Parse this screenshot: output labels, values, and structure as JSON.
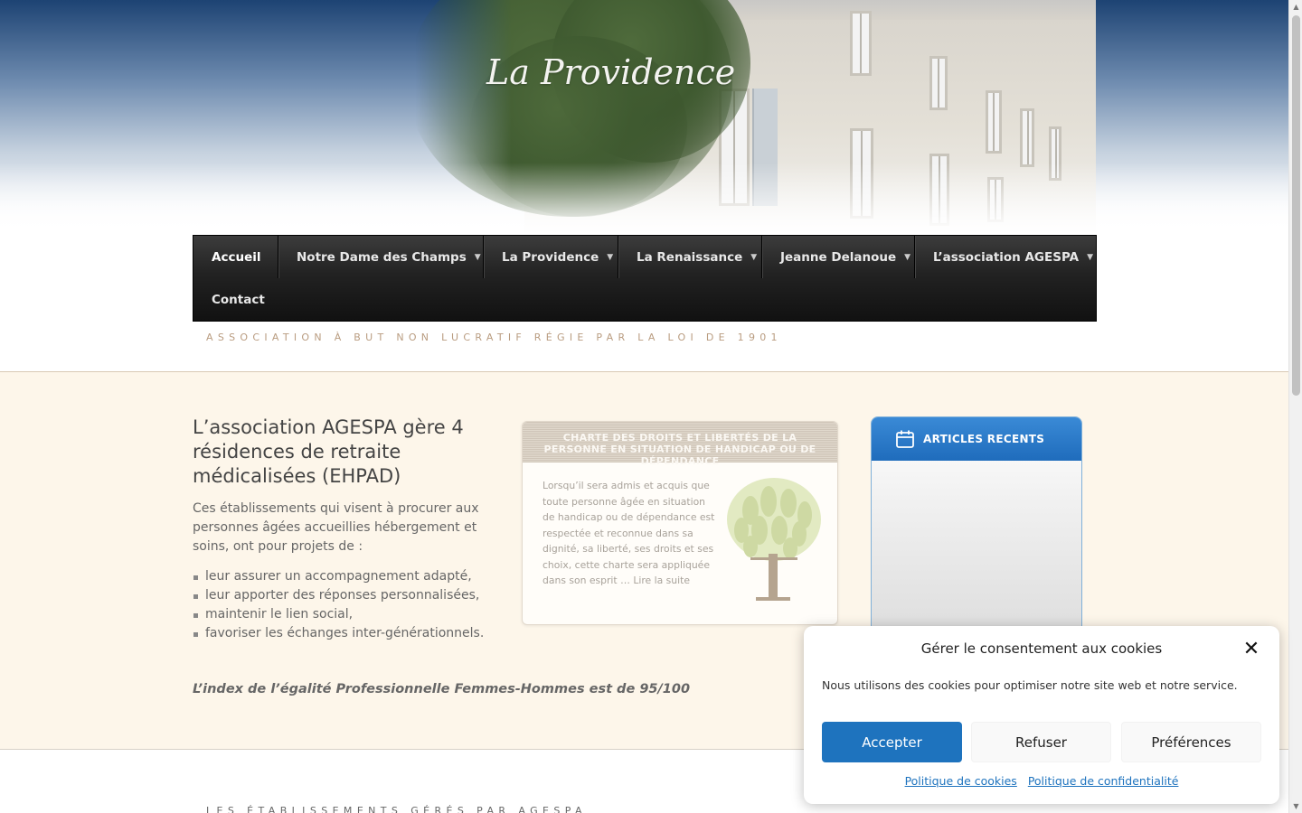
{
  "header": {
    "logo_text": "La Providence"
  },
  "nav": {
    "items": [
      {
        "label": "Accueil",
        "has_submenu": false,
        "active": true
      },
      {
        "label": "Notre Dame des Champs",
        "has_submenu": true
      },
      {
        "label": "La Providence",
        "has_submenu": true
      },
      {
        "label": "La Renaissance",
        "has_submenu": true
      },
      {
        "label": "Jeanne Delanoue",
        "has_submenu": true
      },
      {
        "label": "L’association AGESPA",
        "has_submenu": true
      },
      {
        "label": "Contact",
        "has_submenu": false
      }
    ],
    "submenu_icon": "chevron-down-icon"
  },
  "tagline": "ASSOCIATION À BUT NON LUCRATIF RÉGIE PAR LA LOI DE 1901",
  "main": {
    "title": "L’association AGESPA gère 4 résidences de retraite médicalisées (EHPAD)",
    "intro": "Ces établissements qui visent à procurer aux personnes âgées accueillies hébergement et soins, ont pour projets de :",
    "bullets": [
      "leur assurer un accompagnement adapté,",
      "leur apporter des réponses personnalisées,",
      " maintenir le lien social,",
      "favoriser les échanges inter-générationnels."
    ],
    "index_line": "L’index de l’égalité Professionnelle Femmes-Hommes est de 95/100"
  },
  "card": {
    "heading": "CHARTE DES DROITS ET LIBERTÉS DE LA PERSONNE EN SITUATION DE HANDICAP OU DE DÉPENDANCE",
    "body": "Lorsqu’il sera admis et acquis que toute personne âgée en situation de handicap ou de dépendance est respectée et reconnue dans sa dignité, sa liberté, ses droits et ses choix, cette charte sera appliquée dans son esprit …  Lire la suite",
    "image_icon": "tree-illustration"
  },
  "sidebar": {
    "widget_title": "ARTICLES RECENTS",
    "widget_icon": "calendar-icon"
  },
  "bottom_heading": "LES ÉTABLISSEMENTS GÉRÉS PAR AGESPA",
  "cookie": {
    "title": "Gérer le consentement aux cookies",
    "message": "Nous utilisons des cookies pour optimiser notre site web et notre service.",
    "accept": "Accepter",
    "refuse": "Refuser",
    "preferences": "Préférences",
    "link_cookies": "Politique de cookies",
    "link_privacy": "Politique de confidentialité",
    "close_icon": "close-icon"
  },
  "colors": {
    "nav_bg": "#222222",
    "band_bg": "#fdf6ea",
    "accent_blue": "#1e73be",
    "tagline": "#b99c80"
  }
}
